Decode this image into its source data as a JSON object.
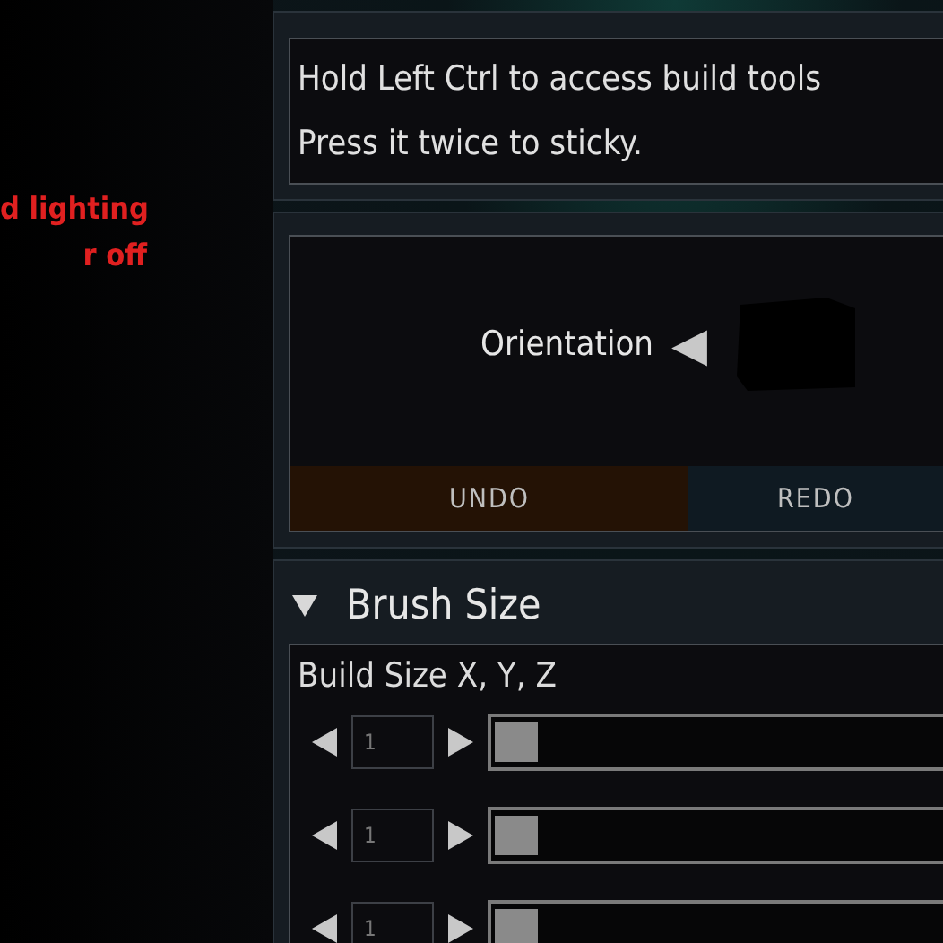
{
  "warning_lines": [
    "d lighting",
    "r off"
  ],
  "hint": {
    "lines": [
      "Hold Left Ctrl to access build tools",
      "Press it twice to sticky."
    ]
  },
  "orientation": {
    "label": "Orientation",
    "arrow": "◀"
  },
  "history_buttons": [
    {
      "label": "UNDO",
      "kind": "undo"
    },
    {
      "label": "REDO",
      "kind": "redo"
    }
  ],
  "brush_size": {
    "title": "Brush Size",
    "expanded": true,
    "label": "Build Size X, Y, Z",
    "sliders": [
      {
        "value": "1",
        "level": 0
      },
      {
        "value": "1",
        "level": 0
      },
      {
        "value": "1",
        "level": 0
      }
    ]
  }
}
